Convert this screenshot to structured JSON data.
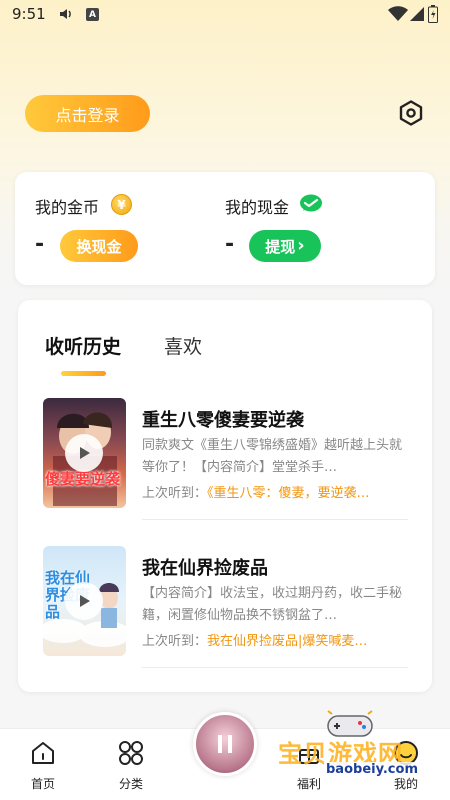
{
  "status_bar": {
    "time": "9:51",
    "a_glyph": "A"
  },
  "header": {
    "login_label": "点击登录"
  },
  "wallet": {
    "coins_label": "我的金币",
    "coins_value": "-",
    "coin_glyph": "¥",
    "exchange_label": "换现金",
    "cash_label": "我的现金",
    "cash_value": "-",
    "withdraw_label": "提现",
    "withdraw_chevron": "›"
  },
  "history": {
    "tabs": [
      {
        "label": "收听历史",
        "active": true
      },
      {
        "label": "喜欢",
        "active": false
      }
    ],
    "items": [
      {
        "title": "重生八零傻妻要逆袭",
        "desc": "同款爽文《重生八零锦绣盛婚》越听越上头就等你了！【内容简介】堂堂杀手…",
        "last_prefix": "上次听到：",
        "last_title": "《重生八零：傻妻，要逆袭…",
        "cover_text": "傻妻要逆袭"
      },
      {
        "title": "我在仙界捡废品",
        "desc": "【内容简介】收法宝，收过期丹药，收二手秘籍，闲置修仙物品换不锈钢盆了…",
        "last_prefix": "上次听到：",
        "last_title": "我在仙界捡废品|爆笑喊麦…",
        "cover_text": "我在仙界捡废品"
      }
    ]
  },
  "bottom_nav": {
    "home": "首页",
    "category": "分类",
    "welfare": "福利",
    "mine": "我的"
  },
  "watermark": {
    "text": "宝贝游戏网",
    "url": "baobeiy.com"
  },
  "colors": {
    "accent": "#ff9b1a",
    "green": "#18c45a",
    "orange_text": "#f2960f"
  }
}
